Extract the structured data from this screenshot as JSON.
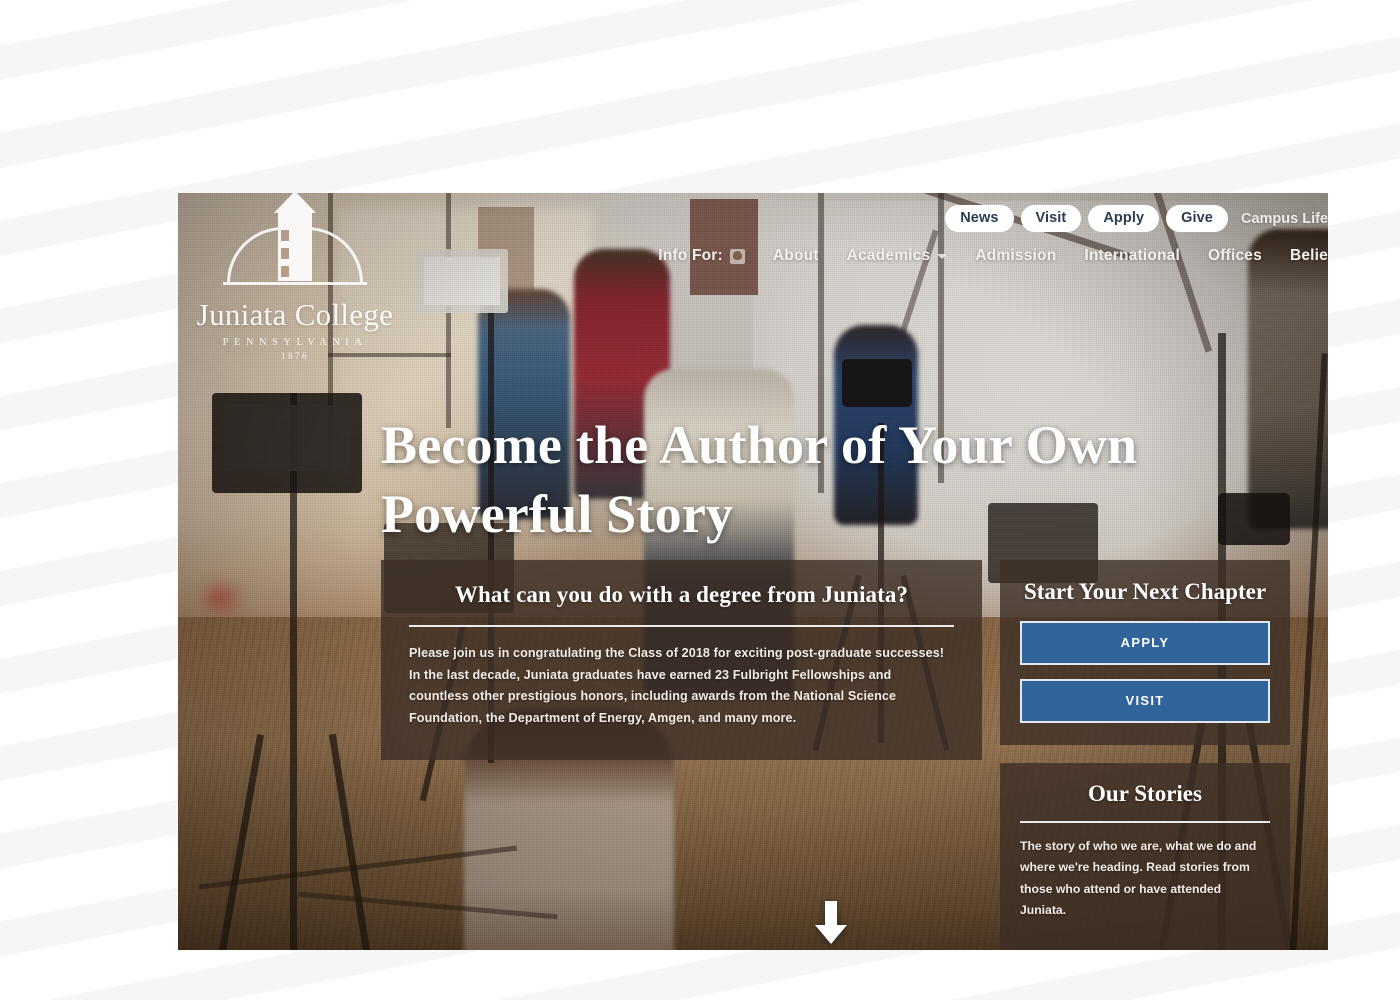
{
  "site": {
    "logo": {
      "name": "Juniata College",
      "state": "PENNSYLVANIA",
      "year": "1876"
    }
  },
  "utility_nav": {
    "items": [
      {
        "label": "News",
        "style": "pill"
      },
      {
        "label": "Visit",
        "style": "pill"
      },
      {
        "label": "Apply",
        "style": "pill"
      },
      {
        "label": "Give",
        "style": "pill"
      },
      {
        "label": "Campus Life",
        "style": "plain"
      }
    ]
  },
  "main_nav": {
    "info_for_label": "Info For:",
    "info_for_icon": "user-icon",
    "items": [
      {
        "label": "About",
        "has_dropdown": false
      },
      {
        "label": "Academics",
        "has_dropdown": true
      },
      {
        "label": "Admission",
        "has_dropdown": false
      },
      {
        "label": "International",
        "has_dropdown": false
      },
      {
        "label": "Offices",
        "has_dropdown": false
      },
      {
        "label": "Belie",
        "has_dropdown": false
      }
    ]
  },
  "hero": {
    "headline": "Become the Author of Your Own Powerful Story",
    "scroll_icon": "arrow-down-icon"
  },
  "degree_panel": {
    "heading": "What can you do with a degree from Juniata?",
    "body": "Please join us in congratulating the Class of 2018 for exciting post-graduate successes! In the last decade, Juniata graduates have earned 23 Fulbright Fellowships and countless other prestigious honors, including awards from the National Science Foundation, the Department of Energy, Amgen, and many more."
  },
  "chapter_panel": {
    "heading": "Start Your Next Chapter",
    "apply_label": "APPLY",
    "visit_label": "VISIT"
  },
  "stories_panel": {
    "heading": "Our Stories",
    "body": "The story of who we are, what we do and where we're heading. Read stories from those who attend or have attended Juniata."
  },
  "colors": {
    "button_blue": "#30649B",
    "panel_overlay": "#3C2E26",
    "pill_text": "#2B3D55",
    "text_light": "#F2ECE7"
  }
}
